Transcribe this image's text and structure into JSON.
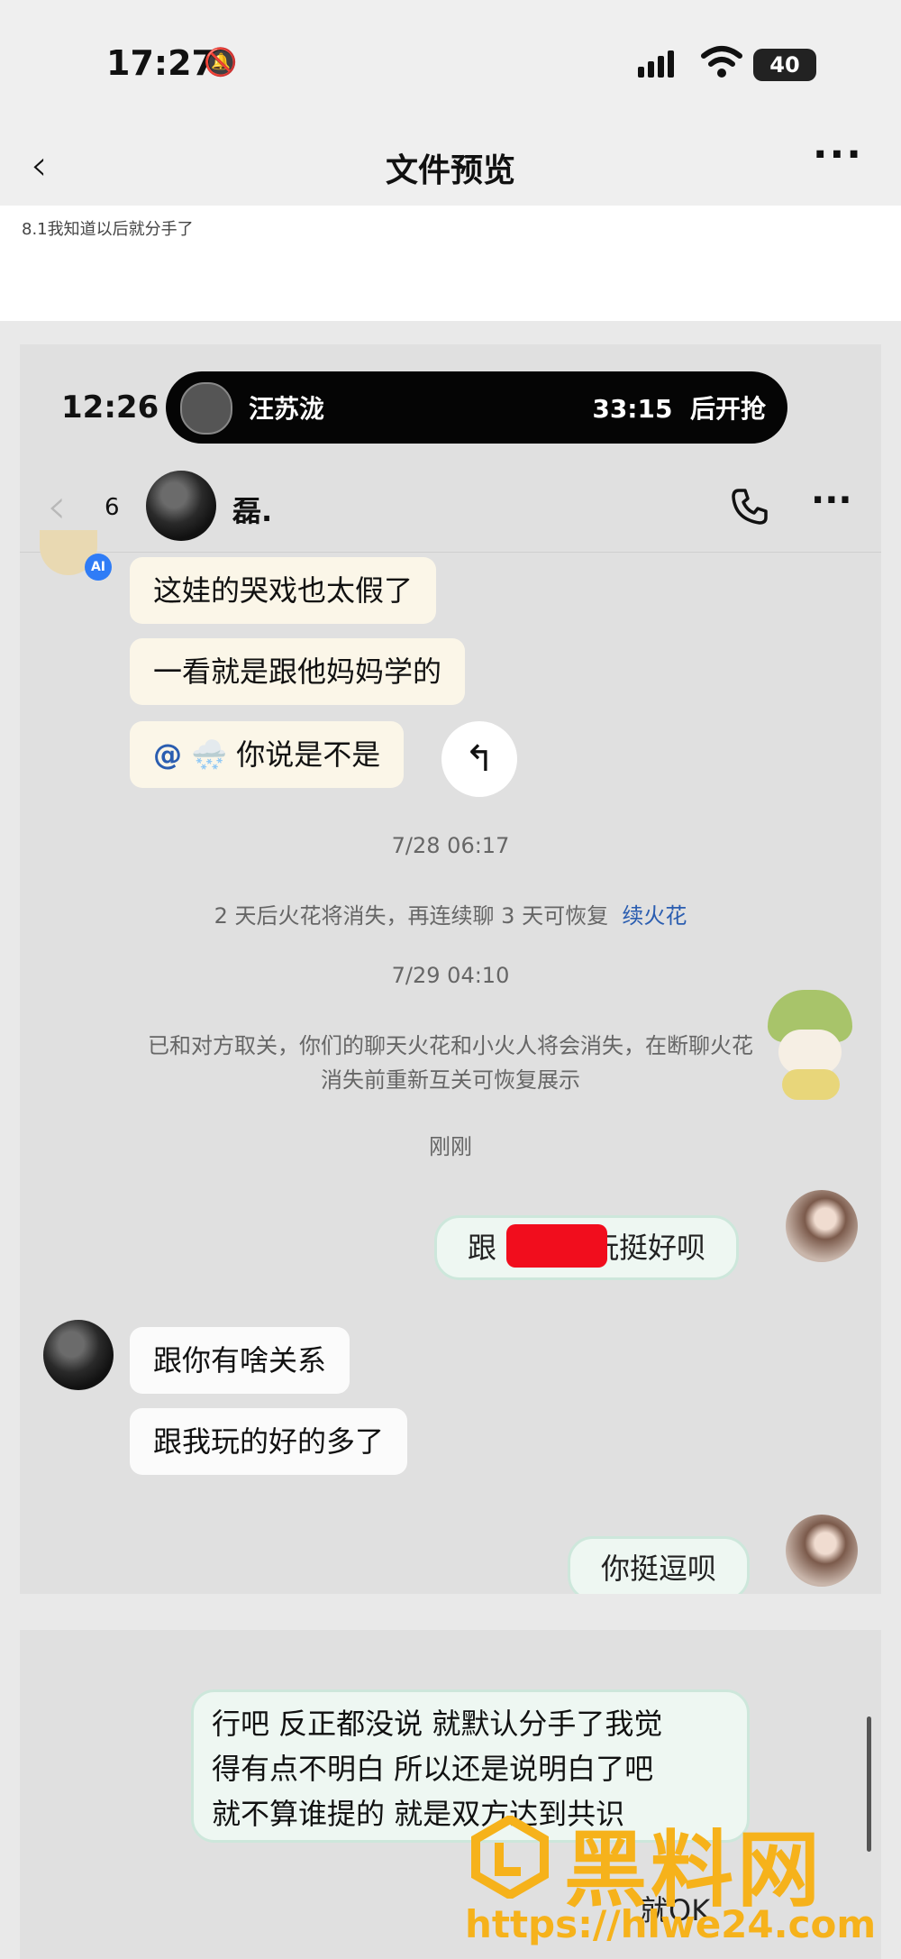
{
  "status_bar": {
    "time": "17:27",
    "battery": "40"
  },
  "nav": {
    "title": "文件预览"
  },
  "caption": "8.1我知道以后就分手了",
  "inner": {
    "time": "12:26",
    "pill_name": "汪苏泷",
    "pill_countdown": "33:15",
    "pill_action": "后开抢",
    "back_count": "6",
    "contact_name": "磊.",
    "ai_badge": "AI"
  },
  "messages": {
    "m1": "这娃的哭戏也太假了",
    "m2": "一看就是跟他妈妈学的",
    "m3_at": "@",
    "m3_text": "你说是不是",
    "ts1": "7/28 06:17",
    "spark_notice": "2 天后火花将消失，再连续聊 3 天可恢复",
    "spark_link": "续火花",
    "ts2": "7/29 04:10",
    "unfollow_line1": "已和对方取关，你们的聊天火花和小火人将会消失，在断聊火花",
    "unfollow_line2": "消失前重新互关可恢复展示",
    "ts3": "刚刚",
    "me1_a": "跟",
    "me1_b": "玩挺好呗",
    "r1": "跟你有啥关系",
    "r2": "跟我玩的好的多了",
    "me2": "你挺逗呗",
    "me3_line1": "行吧 反正都没说 就默认分手了我觉",
    "me3_line2": "得有点不明白 所以还是说明白了吧",
    "me3_line3": "就不算谁提的 就是双方达到共识",
    "me4": "就OK"
  },
  "watermark": {
    "name": "黑料网",
    "url": "https://hlwe24.com"
  }
}
